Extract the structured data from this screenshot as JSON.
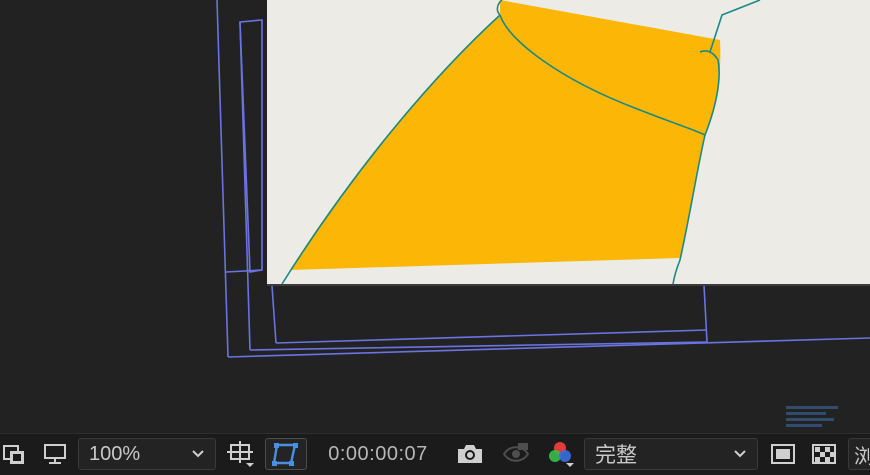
{
  "toolbar": {
    "zoom": {
      "value": "100%"
    },
    "timecode": "0:00:00:07",
    "resolution": {
      "value": "完整"
    },
    "partial_label": "浏"
  },
  "colors": {
    "viewer_bg": "#222223",
    "comp_bg": "#ecebe6",
    "shape_fill": "#fbb606",
    "shape_stroke": "#1a8a86",
    "guide_lines": "#6a73e0",
    "active_icon": "#4a90e2"
  },
  "icons": [
    "comp-flowchart-icon",
    "monitor-icon",
    "region-of-interest-icon",
    "mask-path-visibility-icon",
    "camera-snapshot-icon",
    "show-snapshot-icon",
    "color-channels-icon",
    "fast-preview-icon",
    "transparency-grid-icon"
  ]
}
